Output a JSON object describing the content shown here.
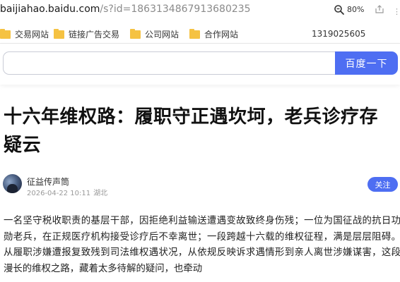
{
  "browser": {
    "url_host": "baijiahao.baidu.com",
    "url_path": "/s?id=1863134867913680235",
    "zoom": "80%",
    "icons": {
      "zoom": "magnifier-icon",
      "share": "share-icon"
    }
  },
  "bookmarks": {
    "items": [
      {
        "label": "交易网站"
      },
      {
        "label": "链接广告交易"
      },
      {
        "label": "公司网站"
      },
      {
        "label": "合作网站"
      }
    ],
    "phone": "1319025605"
  },
  "search": {
    "value": "",
    "placeholder": "",
    "button_label": "百度一下"
  },
  "article": {
    "title": "十六年维权路：履职守正遇坎坷，老兵诊疗存疑云",
    "author": "征益传声筒",
    "date": "2026-04-22 10:11",
    "location": "湖北",
    "follow_label": "关注",
    "body": "一名坚守税收职责的基层干部，因拒绝利益输送遭遇变故致终身伤残；一位为国征战的抗日功勋老兵，在正规医疗机构接受诊疗后不幸离世；一段跨越十六载的维权征程，满是层层阻碍。从履职涉嫌遭报复致残到司法维权遇状况，从依规反映诉求遇情形到亲人离世涉嫌谋害，这段漫长的维权之路，藏着太多待解的疑问，也牵动"
  },
  "colors": {
    "accent": "#4e6ef2",
    "folder": "#f5c242"
  }
}
